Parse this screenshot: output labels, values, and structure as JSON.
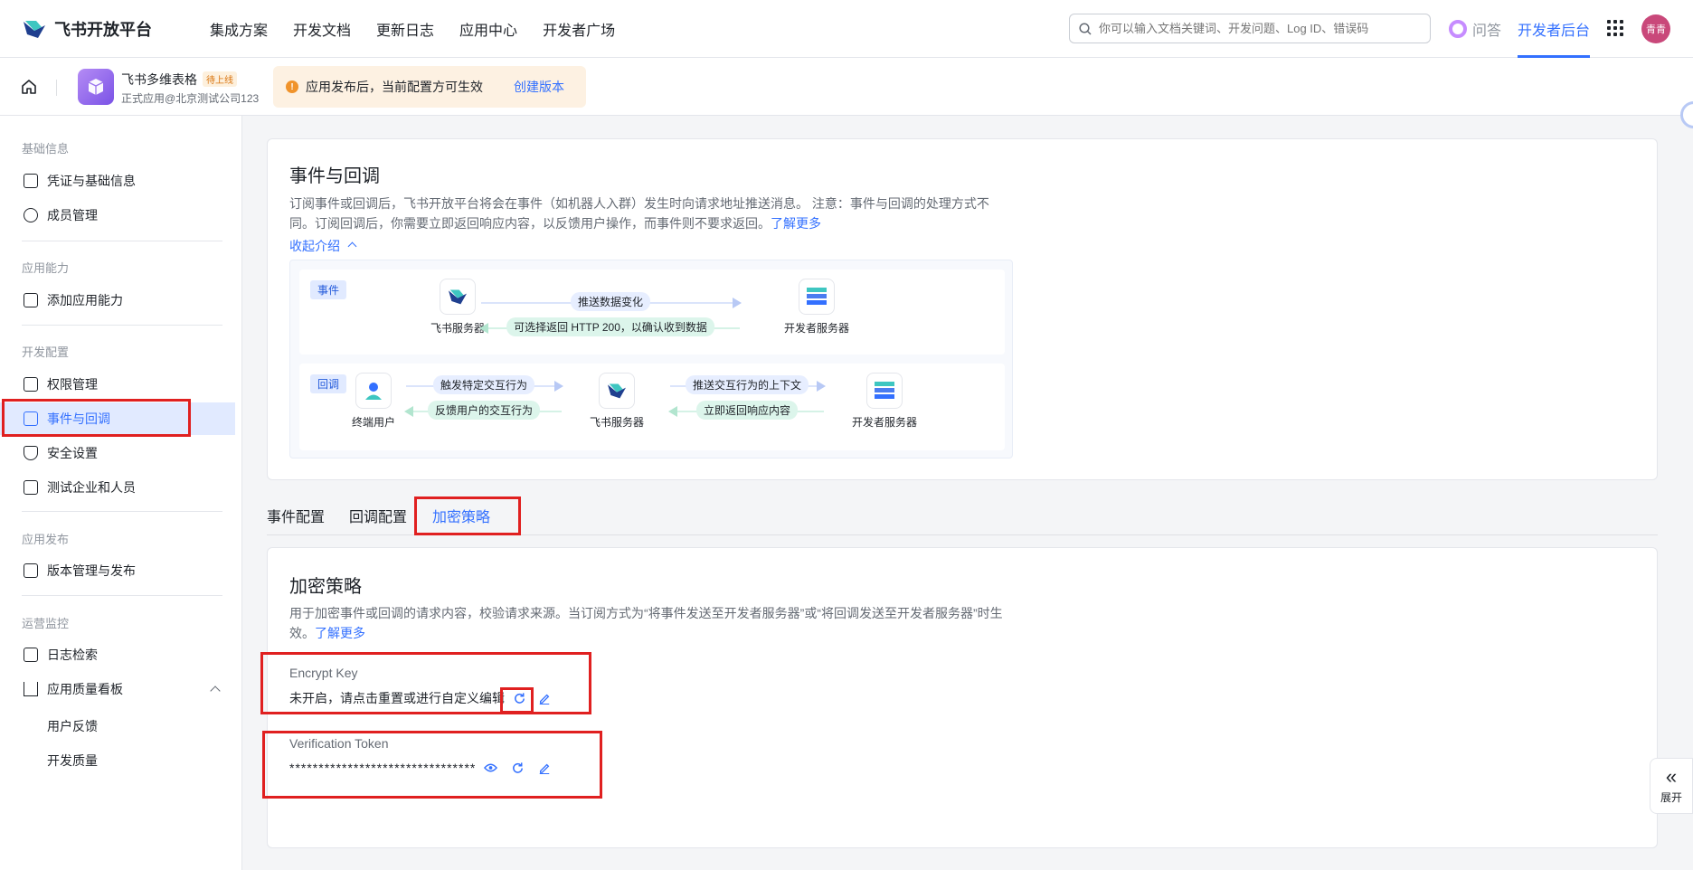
{
  "header": {
    "brand": "飞书开放平台",
    "nav": [
      "集成方案",
      "开发文档",
      "更新日志",
      "应用中心",
      "开发者广场"
    ],
    "search_placeholder": "你可以输入文档关键词、开发问题、Log ID、错误码",
    "qa_label": "问答",
    "dev_console": "开发者后台",
    "avatar_text": "青青"
  },
  "app_bar": {
    "app_name": "飞书多维表格",
    "status_badge": "待上线",
    "app_subtitle": "正式应用@北京测试公司123",
    "notice_text": "应用发布后，当前配置方可生效",
    "notice_link": "创建版本"
  },
  "sidebar": {
    "groups": [
      {
        "title": "基础信息",
        "items": [
          "凭证与基础信息",
          "成员管理"
        ]
      },
      {
        "title": "应用能力",
        "items": [
          "添加应用能力"
        ]
      },
      {
        "title": "开发配置",
        "items": [
          "权限管理",
          "事件与回调",
          "安全设置",
          "测试企业和人员"
        ]
      },
      {
        "title": "应用发布",
        "items": [
          "版本管理与发布"
        ]
      },
      {
        "title": "运营监控",
        "items": [
          "日志检索",
          "应用质量看板"
        ]
      }
    ],
    "sub_items": [
      "用户反馈",
      "开发质量"
    ],
    "active_item": "事件与回调"
  },
  "intro": {
    "title": "事件与回调",
    "desc": "订阅事件或回调后，飞书开放平台将会在事件（如机器人入群）发生时向请求地址推送消息。 注意：事件与回调的处理方式不同。订阅回调后，你需要立即返回响应内容，以反馈用户操作，而事件则不要求返回。",
    "learn_more": "了解更多",
    "collapse": "收起介绍"
  },
  "diagram": {
    "event_tag": "事件",
    "callback_tag": "回调",
    "feishu_server": "飞书服务器",
    "dev_server": "开发者服务器",
    "end_user": "终端用户",
    "push_data": "推送数据变化",
    "optional_return": "可选择返回 HTTP 200，以确认收到数据",
    "trigger_action": "触发特定交互行为",
    "feedback_action": "反馈用户的交互行为",
    "push_context": "推送交互行为的上下文",
    "return_response": "立即返回响应内容"
  },
  "tabs": [
    "事件配置",
    "回调配置",
    "加密策略"
  ],
  "active_tab": "加密策略",
  "encryption": {
    "title": "加密策略",
    "desc": "用于加密事件或回调的请求内容，校验请求来源。当订阅方式为“将事件发送至开发者服务器”或“将回调发送至开发者服务器”时生效。",
    "learn_more": "了解更多",
    "encrypt_key_label": "Encrypt Key",
    "encrypt_key_value": "未开启，请点击重置或进行自定义编辑",
    "token_label": "Verification Token",
    "token_value": "********************************"
  },
  "expand_label": "展开",
  "colors": {
    "accent": "#3370ff",
    "highlight_box": "#e02020",
    "active_bg": "#e1eaff"
  }
}
